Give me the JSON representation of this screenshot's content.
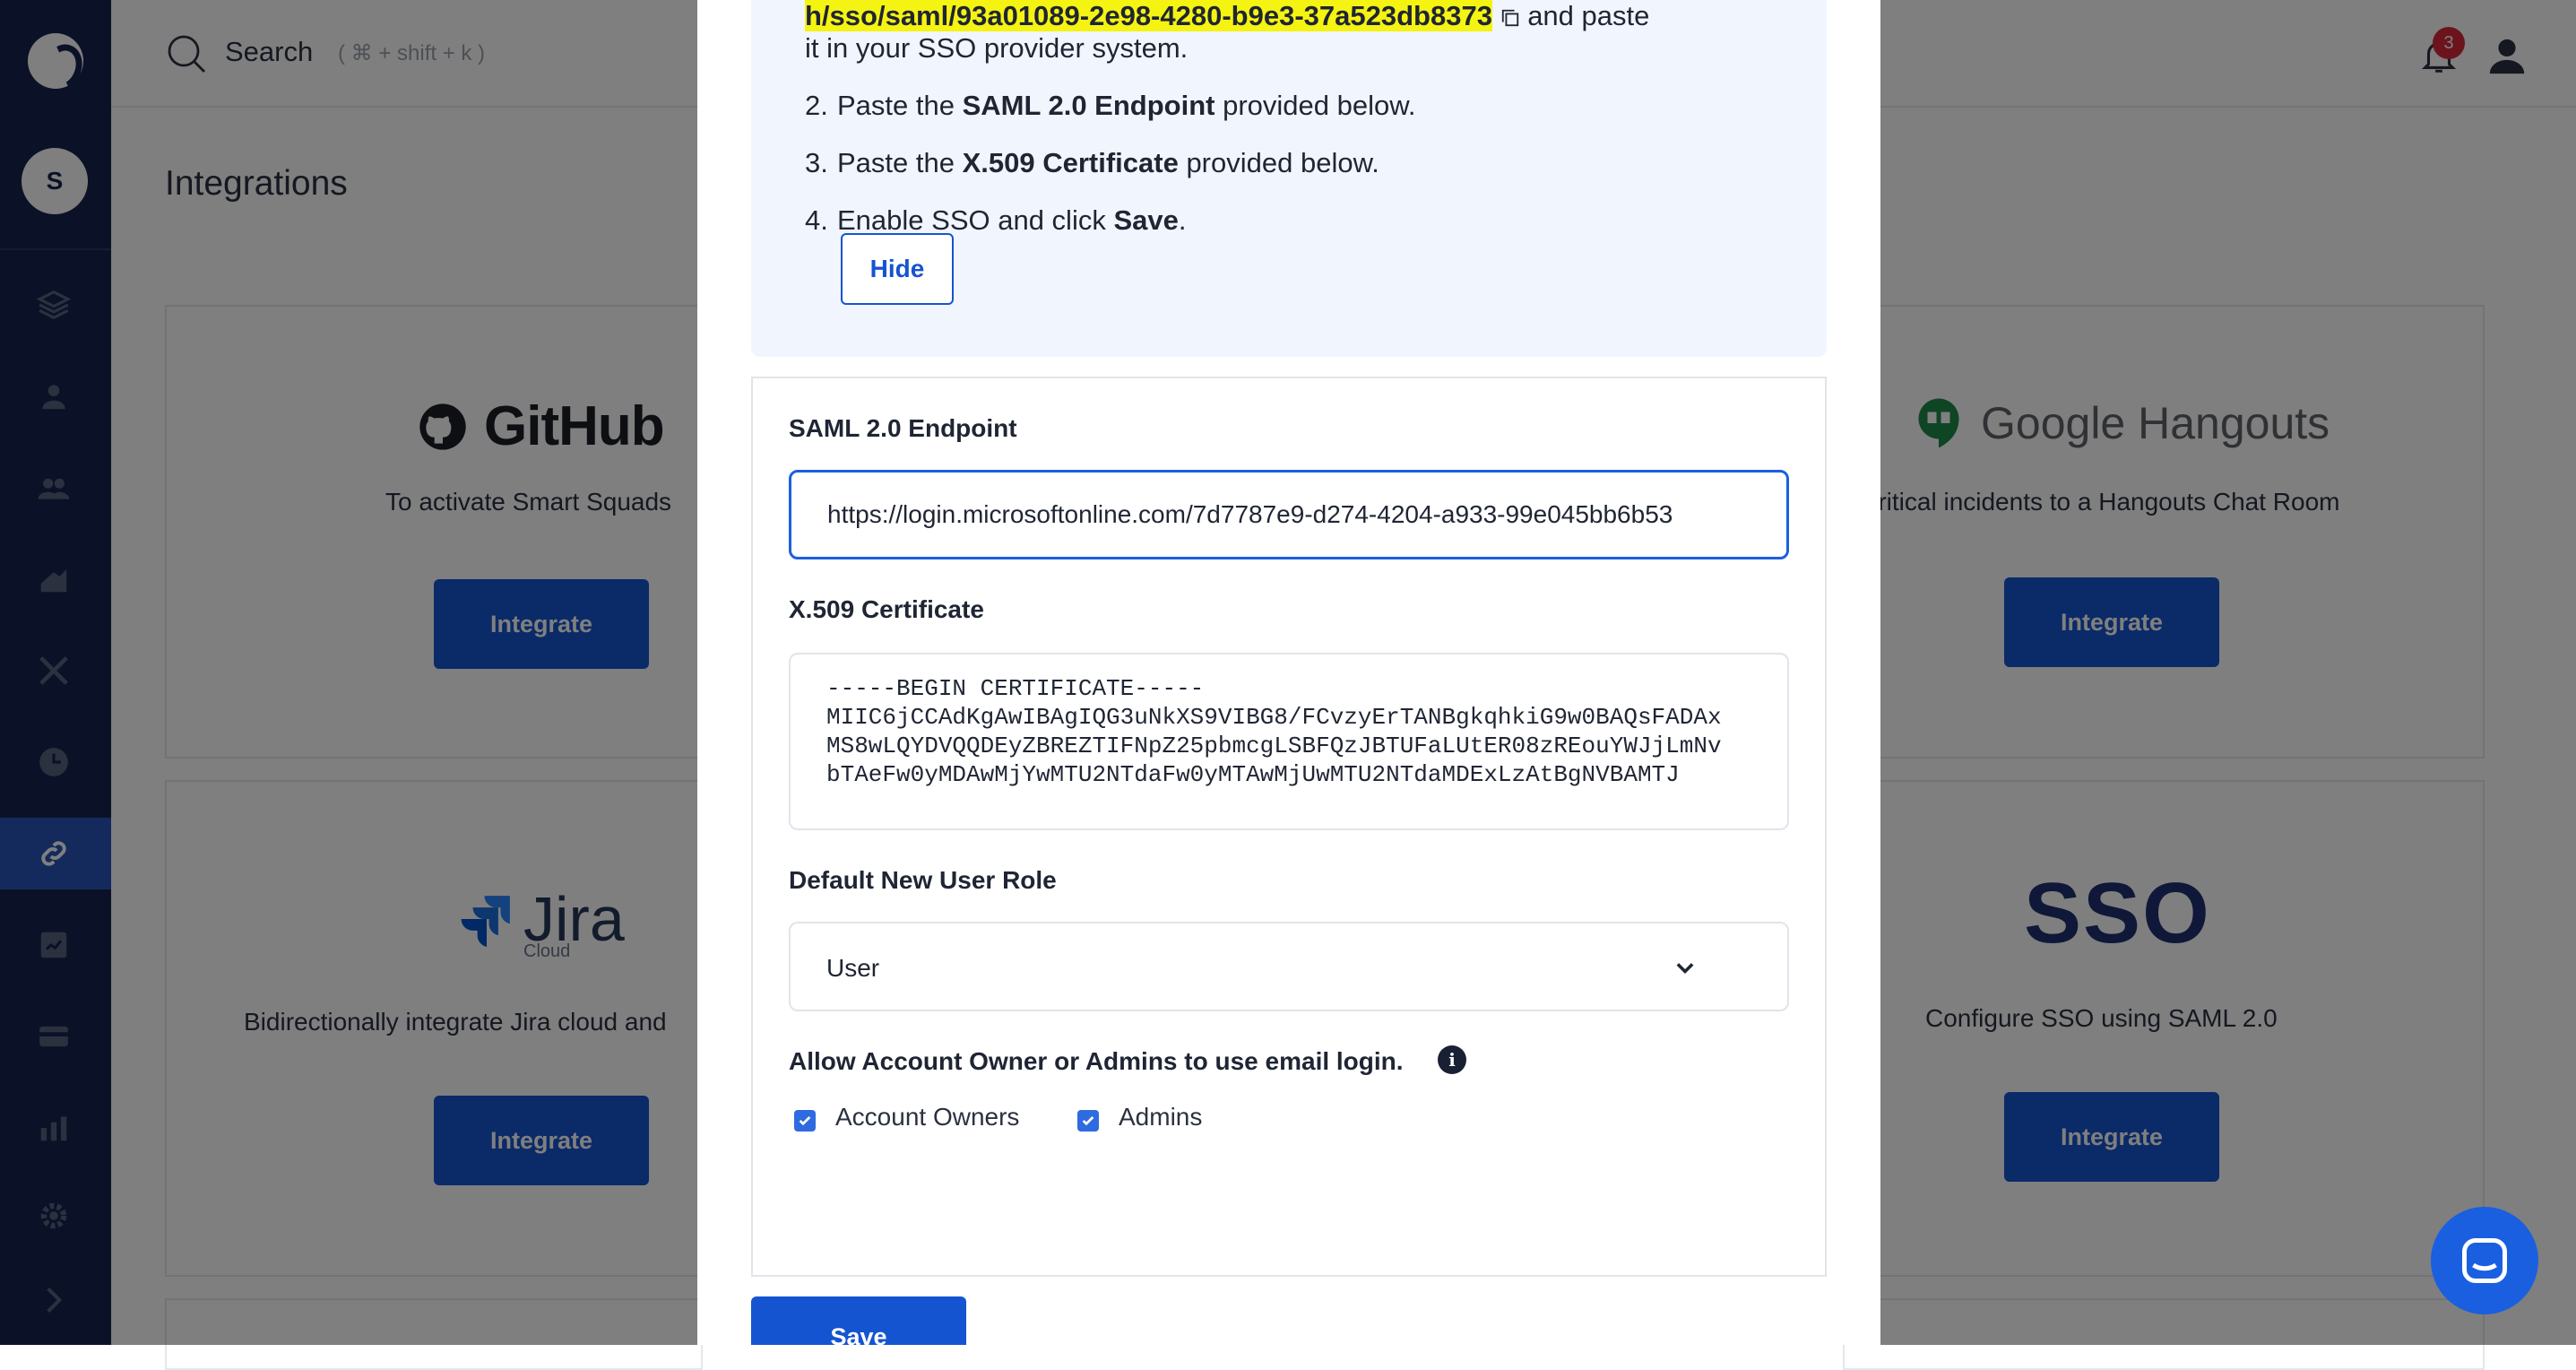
{
  "sidebar": {
    "avatar_initial": "S",
    "icons": [
      "logo-icon",
      "layers-icon",
      "user-icon",
      "team-icon",
      "chart-icon",
      "tools-icon",
      "clock-icon",
      "link-icon",
      "report-icon",
      "card-icon",
      "analytics-icon",
      "gear-icon",
      "chevron-right-icon"
    ]
  },
  "topbar": {
    "search_label": "Search",
    "search_hint": "( ⌘ + shift + k )",
    "notification_count": "3"
  },
  "page": {
    "title": "Integrations"
  },
  "cards": {
    "github": {
      "logo_text": "GitHub",
      "desc": "To activate Smart Squads",
      "button": "Integrate"
    },
    "hangouts": {
      "logo_text": "Google Hangouts",
      "desc": "e critical incidents to a Hangouts Chat Room",
      "button": "Integrate"
    },
    "jira": {
      "logo_text": "Jira",
      "logo_sub": "Cloud",
      "desc": "Bidirectionally integrate Jira cloud and",
      "button": "Integrate"
    },
    "sso": {
      "logo_text": "SSO",
      "desc": "Configure SSO using SAML 2.0",
      "button": "Integrate"
    }
  },
  "modal": {
    "step1_url": "h/sso/saml/93a01089-2e98-4280-b9e3-37a523db8373",
    "step1_tail": " and paste",
    "step1_line2": "it in your SSO provider system.",
    "step2_pre": "Paste the ",
    "step2_bold": "SAML 2.0 Endpoint",
    "step2_post": " provided below.",
    "step3_pre": "Paste the ",
    "step3_bold": "X.509 Certificate",
    "step3_post": " provided below.",
    "step4_pre": "Enable SSO and click ",
    "step4_bold": "Save",
    "step4_post": ".",
    "hide_button": "Hide",
    "saml_label": "SAML 2.0 Endpoint",
    "saml_value": "https://login.microsoftonline.com/7d7787e9-d274-4204-a933-99e045bb6b53",
    "cert_label": "X.509 Certificate",
    "cert_value": "-----BEGIN CERTIFICATE-----\nMIIC6jCCAdKgAwIBAgIQG3uNkXS9VIBG8/FCvzyErTANBgkqhkiG9w0BAQsFADAx\nMS8wLQYDVQQDEyZBREZTIFNpZ25pbmcgLSBFQzJBTUFaLUtER08zREouYWJjLmNv\nbTAeFw0yMDAwMjYwMTU2NTdaFw0yMTAwMjUwMTU2NTdaMDExLzAtBgNVBAMTJ",
    "role_label": "Default New User Role",
    "role_value": "User",
    "email_login_label": "Allow Account Owner or Admins to use email login.",
    "checkbox_owners": "Account Owners",
    "checkbox_admins": "Admins",
    "save_button": "Save"
  }
}
